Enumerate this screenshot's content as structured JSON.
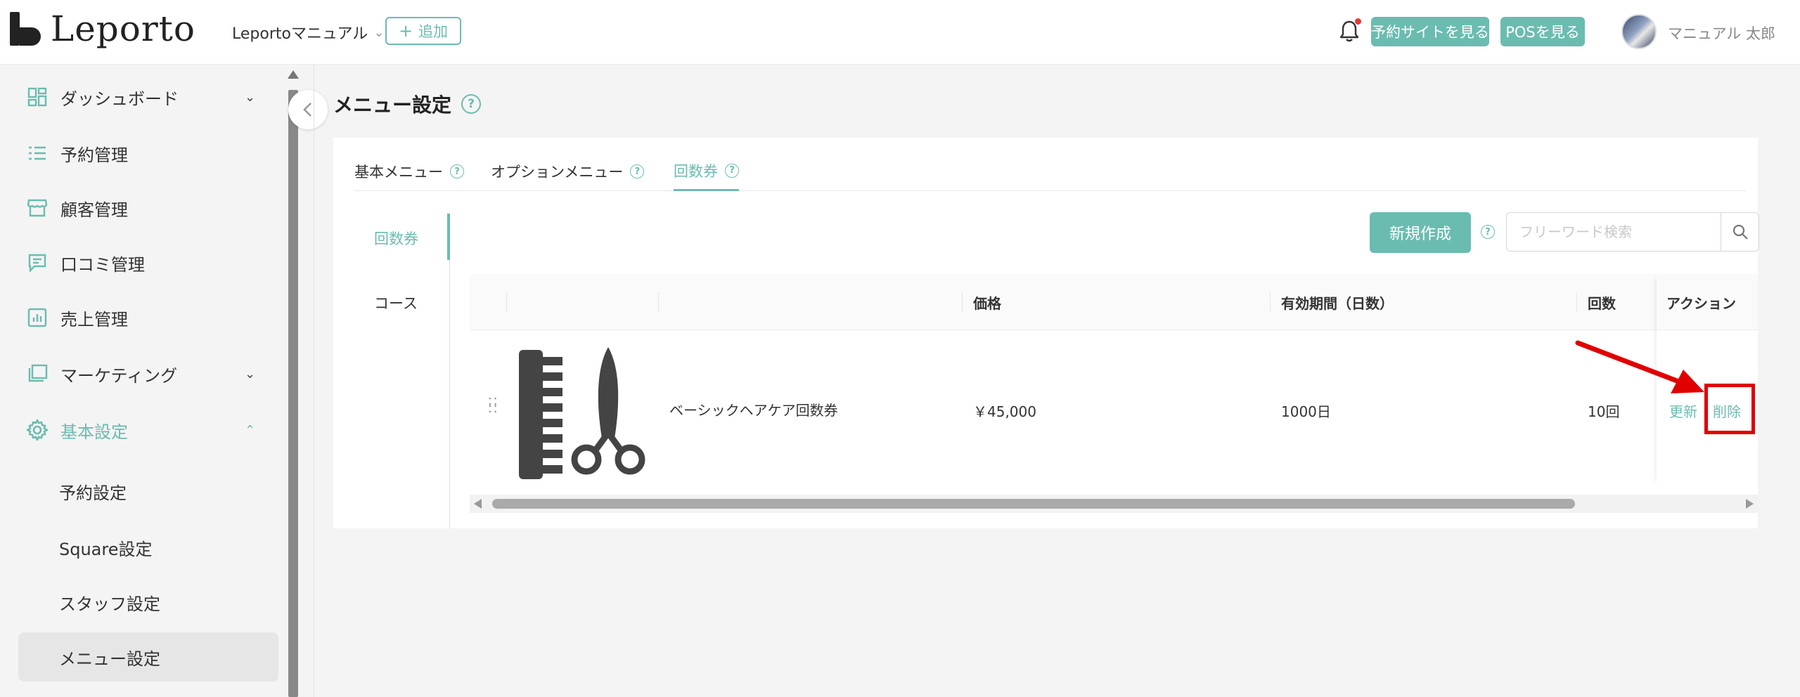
{
  "header": {
    "logo_text": "Leporto",
    "store_name": "Leportoマニュアル",
    "add_label": "追加",
    "site_button": "予約サイトを見る",
    "pos_button": "POSを見る",
    "user_name": "マニュアル 太郎",
    "has_notification": true
  },
  "sidebar": {
    "items": [
      {
        "label": "ダッシュボード",
        "icon": "dashboard-icon",
        "expandable": true
      },
      {
        "label": "予約管理",
        "icon": "list-icon"
      },
      {
        "label": "顧客管理",
        "icon": "store-icon"
      },
      {
        "label": "口コミ管理",
        "icon": "comment-icon"
      },
      {
        "label": "売上管理",
        "icon": "bar-chart-icon"
      },
      {
        "label": "マーケティング",
        "icon": "layers-icon",
        "expandable": true
      },
      {
        "label": "基本設定",
        "icon": "gear-icon",
        "expanded": true,
        "active": true
      }
    ],
    "sub_items": [
      {
        "label": "予約設定"
      },
      {
        "label": "Square設定"
      },
      {
        "label": "スタッフ設定"
      },
      {
        "label": "メニュー設定",
        "selected": true
      }
    ]
  },
  "page": {
    "title": "メニュー設定",
    "tabs": [
      {
        "label": "基本メニュー"
      },
      {
        "label": "オプションメニュー"
      },
      {
        "label": "回数券",
        "active": true
      }
    ],
    "side_tabs": [
      {
        "label": "回数券",
        "active": true
      },
      {
        "label": "コース"
      }
    ],
    "new_button": "新規作成",
    "search_placeholder": "フリーワード検索"
  },
  "table": {
    "columns": [
      "価格",
      "有効期間（日数）",
      "回数",
      "アクション"
    ],
    "rows": [
      {
        "name": "ベーシックヘアケア回数券",
        "image_icon": "comb-scissors-icon",
        "price": "￥45,000",
        "validity": "1000日",
        "count": "10回",
        "actions": {
          "update": "更新",
          "delete": "削除"
        }
      }
    ]
  },
  "colors": {
    "accent": "#6bbcb0",
    "highlight": "#e00000",
    "notification": "#e53935"
  }
}
